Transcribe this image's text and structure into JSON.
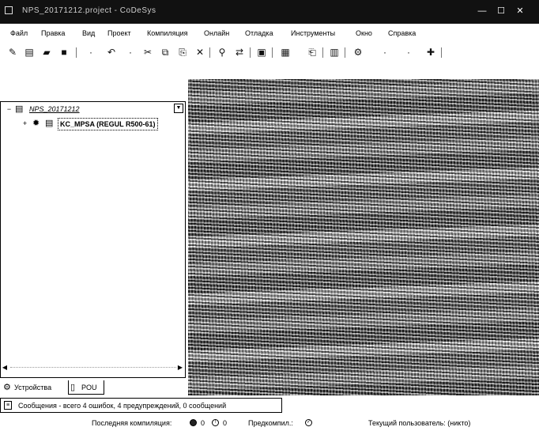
{
  "window": {
    "title": "NPS_20171212.project - CoDeSys",
    "minimize_label": "—",
    "maximize_label": "☐",
    "close_label": "✕"
  },
  "menu": {
    "items": [
      "Файл",
      "Правка",
      "Вид",
      "Проект",
      "Компиляция",
      "Онлайн",
      "Отладка",
      "Инструменты",
      "Окно",
      "Справка"
    ]
  },
  "toolbar": {
    "icons": [
      "new-project-icon",
      "new-file-icon",
      "open-icon",
      "save-icon",
      "print-icon",
      "undo-icon",
      "redo-icon",
      "cut-icon",
      "copy-icon",
      "paste-icon",
      "delete-icon",
      "find-icon",
      "replace-icon",
      "select-all-icon",
      "browse-icon",
      "add-object-icon",
      "build-icon",
      "login-icon",
      "start-icon",
      "stop-icon",
      "tools-icon"
    ]
  },
  "tree": {
    "root": {
      "label": "NPS_20171212",
      "toggle": "−"
    },
    "child": {
      "label": "KC_MPSA (REGUL R500-61)",
      "toggle": "+"
    }
  },
  "tabs": {
    "devices": "Устройства",
    "pou": "POU"
  },
  "messages": {
    "text": "Сообщения - всего 4 ошибок, 4 предупреждений, 0 сообщений"
  },
  "status": {
    "last_compile_label": "Последняя компиляция:",
    "errors_count": "0",
    "warnings_count": "0",
    "precompile_label": "Предкомпил.:",
    "current_user": "Текущий пользователь: (никто)"
  }
}
